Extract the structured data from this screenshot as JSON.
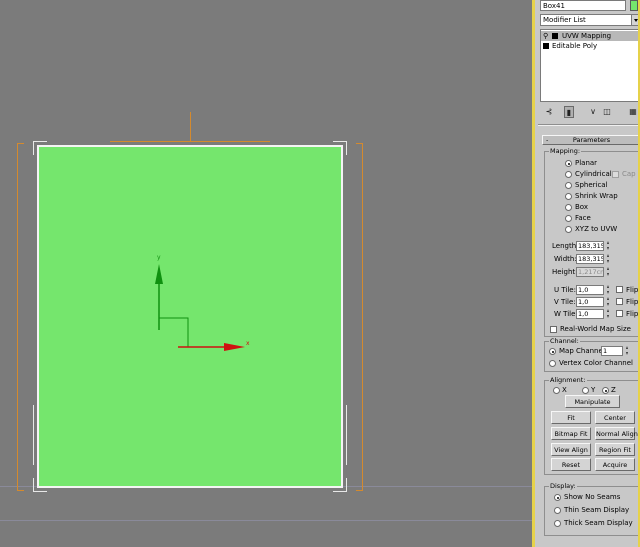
{
  "object_name": "Box41",
  "colors": {
    "plane": "#75e66d",
    "viewport_bg": "#7b7b7b",
    "panel_bg": "#c8c8c8",
    "selected_modifier_bg": "#b8b8b8",
    "x_axis": "#d01010",
    "y_axis": "#109010",
    "orange_gizmo": "#d48a2e",
    "panel_border": "#e6d24a"
  },
  "modifier_list": {
    "label": "Modifier List",
    "items": [
      {
        "label": "UVW Mapping",
        "selected": true
      },
      {
        "label": "Editable Poly",
        "selected": false
      }
    ]
  },
  "toolbar": {
    "icons": [
      "pin-stack-icon",
      "show-end-result-icon",
      "make-unique-icon",
      "remove-modifier-icon",
      "configure-modifier-sets-icon"
    ]
  },
  "rollout": {
    "title": "Parameters",
    "collapse": "-"
  },
  "mapping": {
    "title": "Mapping:",
    "options": [
      {
        "label": "Planar",
        "selected": true
      },
      {
        "label": "Cylindrical",
        "selected": false
      },
      {
        "label": "Spherical",
        "selected": false
      },
      {
        "label": "Shrink Wrap",
        "selected": false
      },
      {
        "label": "Box",
        "selected": false
      },
      {
        "label": "Face",
        "selected": false
      },
      {
        "label": "XYZ to UVW",
        "selected": false
      }
    ],
    "cap_label": "Cap",
    "length_label": "Length:",
    "length_value": "183,315",
    "width_label": "Width:",
    "width_value": "183,315",
    "height_label": "Height:",
    "height_value": "1,217cm",
    "u_tile_label": "U Tile:",
    "u_tile_value": "1,0",
    "v_tile_label": "V Tile:",
    "v_tile_value": "1,0",
    "w_tile_label": "W Tile:",
    "w_tile_value": "1,0",
    "flip_label": "Flip",
    "real_world_label": "Real-World Map Size"
  },
  "channel": {
    "title": "Channel:",
    "map_channel_label": "Map Channel:",
    "map_channel_value": "1",
    "vertex_color_label": "Vertex Color Channel"
  },
  "alignment": {
    "title": "Alignment:",
    "x_label": "X",
    "y_label": "Y",
    "z_label": "Z",
    "selected_axis": "Z",
    "manipulate": "Manipulate",
    "fit": "Fit",
    "center": "Center",
    "bitmap_fit": "Bitmap Fit",
    "normal_align": "Normal Align",
    "view_align": "View Align",
    "region_fit": "Region Fit",
    "reset": "Reset",
    "acquire": "Acquire"
  },
  "display": {
    "title": "Display:",
    "options": [
      {
        "label": "Show No Seams",
        "selected": true
      },
      {
        "label": "Thin Seam Display",
        "selected": false
      },
      {
        "label": "Thick Seam Display",
        "selected": false
      }
    ]
  },
  "gizmo": {
    "x_label": "x",
    "y_label": "y"
  }
}
